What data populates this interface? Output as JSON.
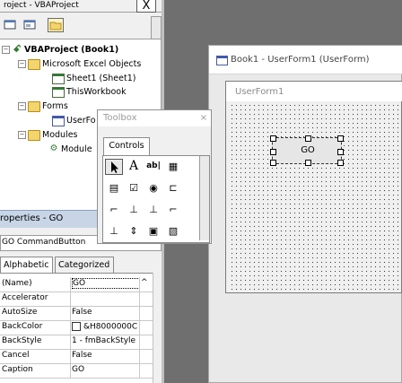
{
  "project": {
    "title": "roject - VBAProject",
    "close_label": "X",
    "tree": [
      {
        "label": "VBAProject (Book1)",
        "bold": true,
        "exp": "−",
        "icon": "project-icon"
      },
      {
        "label": "Microsoft Excel Objects",
        "exp": "−",
        "icon": "folder-icon"
      },
      {
        "label": "Sheet1 (Sheet1)",
        "icon": "sheet-icon"
      },
      {
        "label": "ThisWorkbook",
        "icon": "sheet-icon"
      },
      {
        "label": "Forms",
        "exp": "−",
        "icon": "folder-icon"
      },
      {
        "label": "UserFo",
        "icon": "form-icon"
      },
      {
        "label": "Modules",
        "exp": "−",
        "icon": "folder-icon"
      },
      {
        "label": "Module",
        "icon": "module-icon"
      }
    ]
  },
  "properties": {
    "title": "roperties - GO",
    "object": "GO CommandButton",
    "tabs": [
      "Alphabetic",
      "Categorized"
    ],
    "rows": [
      {
        "name": "(Name)",
        "value": "GO"
      },
      {
        "name": "Accelerator",
        "value": ""
      },
      {
        "name": "AutoSize",
        "value": "False"
      },
      {
        "name": "BackColor",
        "value": "&H8000000C"
      },
      {
        "name": "BackStyle",
        "value": "1 - fmBackStyle"
      },
      {
        "name": "Cancel",
        "value": "False"
      },
      {
        "name": "Caption",
        "value": "GO"
      }
    ]
  },
  "toolbox": {
    "title": "Toolbox",
    "close_label": "×",
    "tab": "Controls",
    "tools": [
      [
        "▲",
        "A",
        "ab|",
        "▦"
      ],
      [
        "▤",
        "☑",
        "◉",
        "⊏"
      ],
      [
        "⌐",
        "⊥",
        "⊥",
        "⌐"
      ],
      [
        "⊥",
        "⇕",
        "▣",
        "▧"
      ]
    ]
  },
  "designer": {
    "title": "Book1 - UserForm1 (UserForm)",
    "form_caption": "UserForm1",
    "button_caption": "GO"
  }
}
